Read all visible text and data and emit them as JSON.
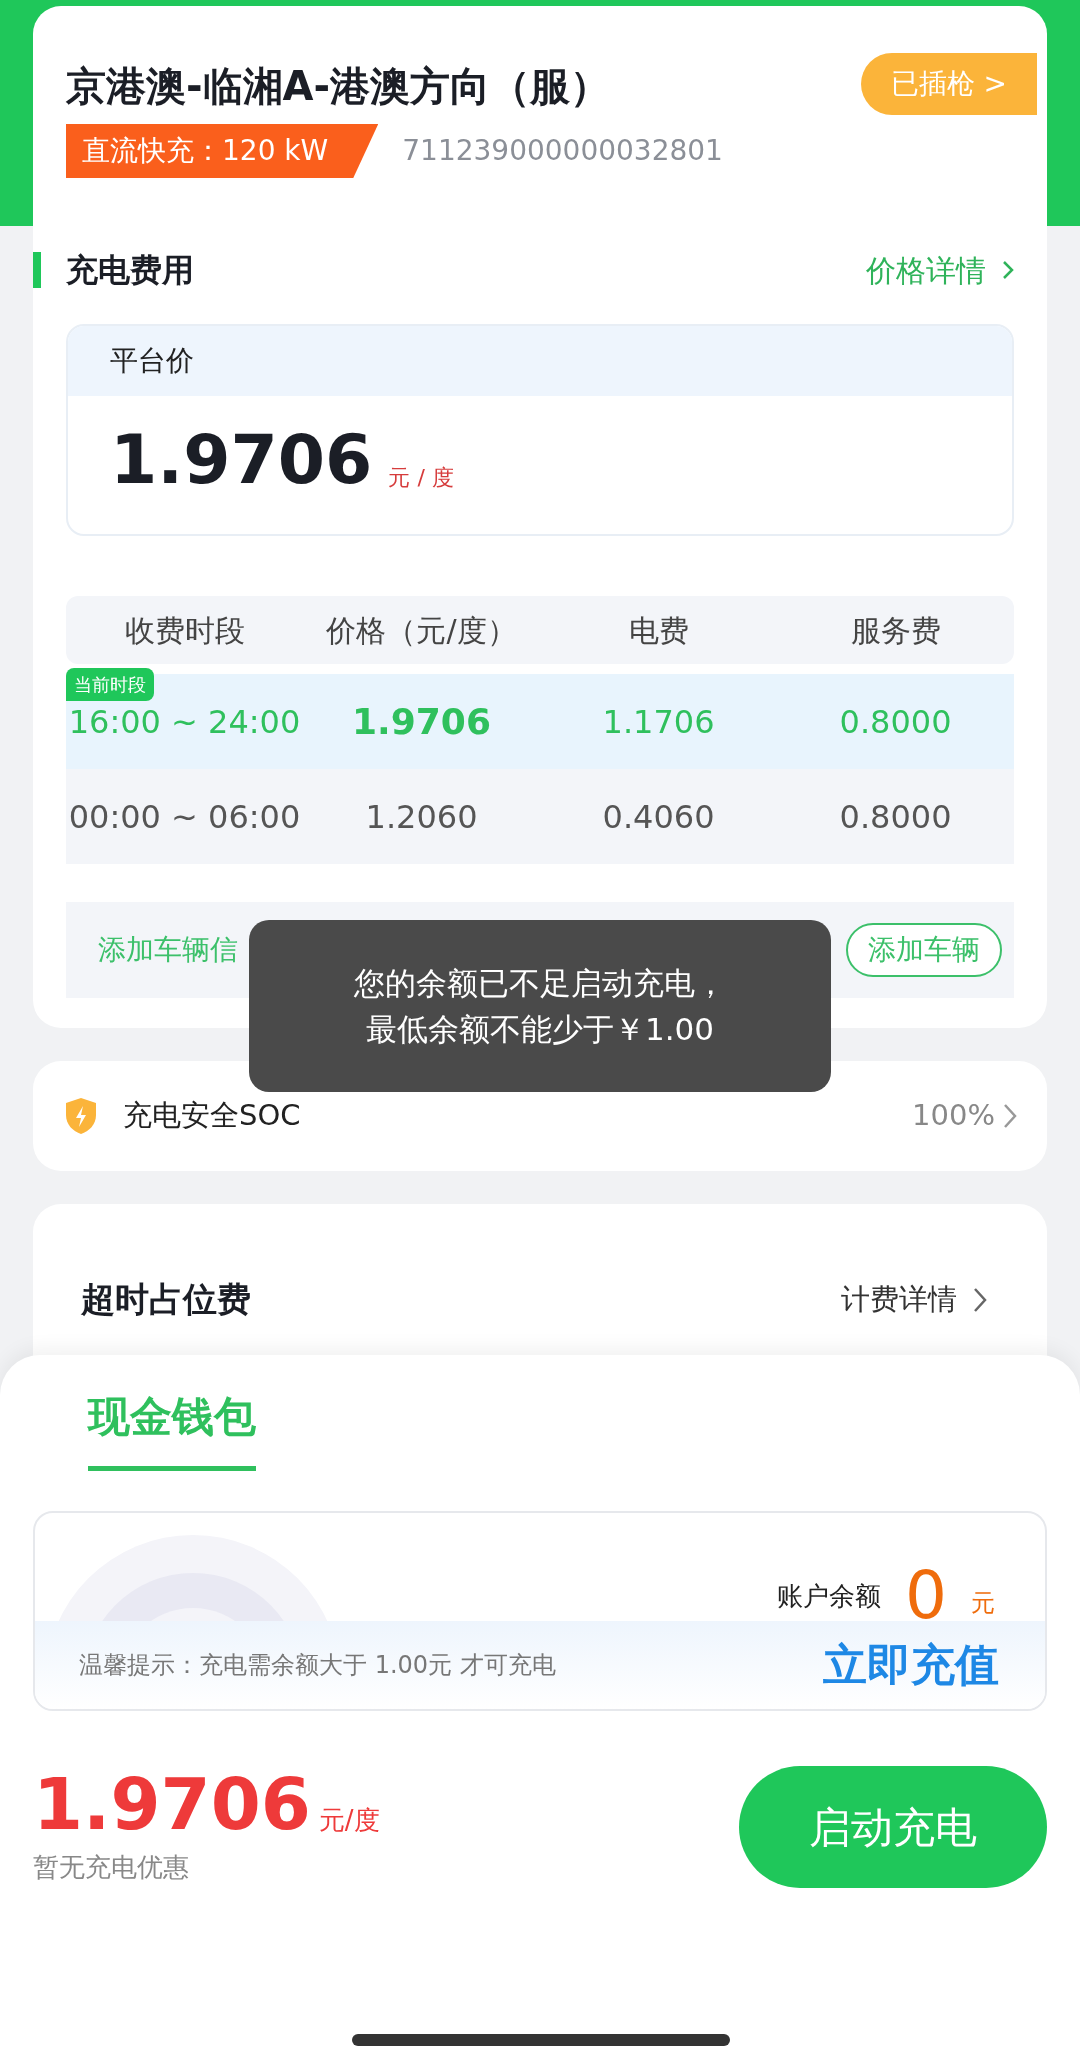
{
  "station": {
    "title": "京港澳-临湘A-港澳方向（服）",
    "plug_status": "已插枪 >",
    "charger_type": "直流快充：120 kW",
    "charger_id": "711239000000032801"
  },
  "fees": {
    "title": "充电费用",
    "details_link": "价格详情",
    "platform_label": "平台价",
    "platform_price": "1.9706",
    "platform_unit": "元 / 度",
    "table": {
      "columns": [
        "收费时段",
        "价格（元/度）",
        "电费",
        "服务费"
      ],
      "rows": [
        {
          "current_tag": "当前时段",
          "selected": true,
          "cells": [
            "16:00 ~ 24:00",
            "1.9706",
            "1.1706",
            "0.8000"
          ]
        },
        {
          "selected": false,
          "cells": [
            "00:00 ~ 06:00",
            "1.2060",
            "0.4060",
            "0.8000"
          ]
        }
      ]
    },
    "vehicle_hint": "添加车辆信",
    "add_vehicle_button": "添加车辆"
  },
  "toast": [
    "您的余额已不足启动充电，",
    "最低余额不能少于￥1.00"
  ],
  "soc": {
    "label": "充电安全SOC",
    "value": "100%"
  },
  "overtime": {
    "label": "超时占位费",
    "details_link": "计费详情"
  },
  "wallet": {
    "tabs": [
      {
        "label": "现金钱包",
        "selected": true
      }
    ],
    "balance_label": "账户余额",
    "balance": "0",
    "balance_unit": "元",
    "tip": "温馨提示：充电需余额大于 1.00元 才可充电",
    "recharge_button": "立即充值"
  },
  "footer": {
    "price": "1.9706",
    "unit": "元/度",
    "discount": "暂无充电优惠",
    "start_button": "启动充电"
  }
}
